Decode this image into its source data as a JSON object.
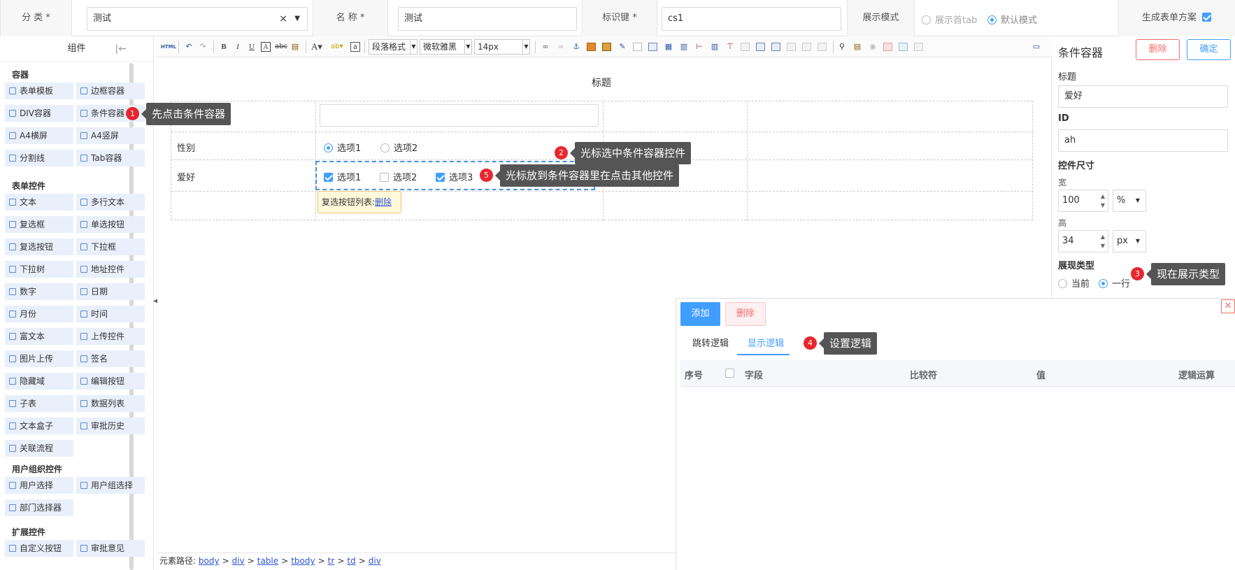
{
  "topbar": {
    "category_label": "分 类",
    "category_value": "测试",
    "name_label": "名 称",
    "name_value": "测试",
    "key_label": "标识键",
    "key_value": "cs1",
    "required_mark": "*",
    "clear_glyph": "×",
    "display_mode_label": "展示模式",
    "display_options": [
      "展示首tab",
      "默认模式"
    ],
    "display_selected": "默认模式",
    "generate_label": "生成表单方案",
    "generate_checked": true
  },
  "left": {
    "title": "组件",
    "groups": [
      {
        "label": "容器",
        "items": [
          "表单模板",
          "边框容器",
          "DIV容器",
          "条件容器",
          "A4横屏",
          "A4竖屏",
          "分割线",
          "Tab容器"
        ]
      },
      {
        "label": "表单控件",
        "items": [
          "文本",
          "多行文本",
          "复选框",
          "单选按钮",
          "复选按钮",
          "下拉框",
          "下拉树",
          "地址控件",
          "数字",
          "日期",
          "月份",
          "时间",
          "富文本",
          "上传控件",
          "图片上传",
          "签名",
          "隐藏域",
          "编辑按钮",
          "子表",
          "数据列表",
          "文本盒子",
          "审批历史",
          "关联流程"
        ]
      },
      {
        "label": "用户组织控件",
        "items": [
          "用户选择",
          "用户组选择",
          "部门选择器"
        ]
      },
      {
        "label": "扩展控件",
        "items": [
          "自定义按钮",
          "审批意见"
        ]
      }
    ]
  },
  "editor": {
    "toolbar": {
      "html_label": "HTML",
      "paragraph": "段落格式",
      "font": "微软雅黑",
      "size": "14px"
    },
    "canvas_title": "标题",
    "rows": [
      {
        "label": ""
      },
      {
        "label": "性别",
        "options": [
          "选项1",
          "选项2"
        ],
        "selected": "选项1"
      },
      {
        "label": "爱好",
        "options": [
          "选项1",
          "选项2",
          "选项3"
        ],
        "checked": [
          "选项1",
          "选项3"
        ]
      }
    ],
    "tooltip_prefix": "复选按钮列表:",
    "tooltip_link": "删除",
    "path_prefix": "元素路径:",
    "path_items": [
      "body",
      "div",
      "table",
      "tbody",
      "tr",
      "td",
      "div"
    ],
    "path_separator": ">"
  },
  "props": {
    "title": "条件容器",
    "delete_label": "删除",
    "ok_label": "确定",
    "caption_label": "标题",
    "caption_value": "爱好",
    "id_label": "ID",
    "id_value": "ah",
    "size_label": "控件尺寸",
    "width_label": "宽",
    "width_value": "100",
    "width_unit": "%",
    "height_label": "高",
    "height_value": "34",
    "height_unit": "px",
    "display_type_label": "展现类型",
    "display_type_options": [
      "当前",
      "一行"
    ],
    "display_type_selected": "一行"
  },
  "logic": {
    "add_label": "添加",
    "delete_label": "删除",
    "close_glyph": "✕",
    "tabs": [
      "跳转逻辑",
      "显示逻辑"
    ],
    "active_tab": "显示逻辑",
    "columns": [
      "序号",
      "字段",
      "比较符",
      "值",
      "逻辑运算"
    ]
  },
  "callouts": [
    {
      "num": "1",
      "text": "先点击条件容器"
    },
    {
      "num": "2",
      "text": "光标选中条件容器控件"
    },
    {
      "num": "3",
      "text": "现在展示类型"
    },
    {
      "num": "4",
      "text": "设置逻辑"
    },
    {
      "num": "5",
      "text": "光标放到条件容器里在点击其他控件"
    }
  ],
  "colors": {
    "accent": "#409eff",
    "danger": "#f56c6c",
    "badge": "#e8262d",
    "callout": "#555555",
    "component_bg": "#e9f0fb"
  },
  "icons": [
    "collapse-left-icon",
    "clear-icon",
    "dropdown-caret-icon",
    "undo-icon",
    "redo-icon",
    "bold-icon",
    "italic-icon",
    "underline-icon",
    "close-icon",
    "checkbox-icon",
    "radio-icon",
    "component-icon"
  ]
}
